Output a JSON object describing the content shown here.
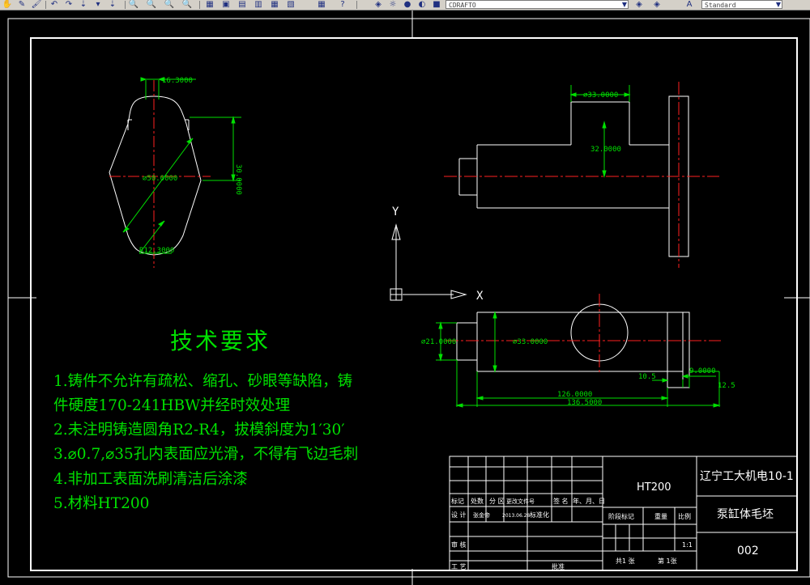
{
  "toolbar": {
    "layer_combo": "CDRAFTO",
    "style_combo": "Standard",
    "icons": [
      "pan-icon",
      "pencil-icon",
      "match-properties-icon",
      "undo-icon",
      "redo-icon",
      "snap-icon",
      "zoom-realtime-icon",
      "zoom-window-icon",
      "zoom-previous-icon",
      "properties-icon",
      "design-center-icon",
      "tool-palettes-icon",
      "calculator-icon",
      "help-icon",
      "layer-manager-icon",
      "layer-state-icon",
      "layer-color-icon",
      "style-icon"
    ]
  },
  "views": {
    "left": {
      "dim_width": "16.3000",
      "dim_height": "30.0000",
      "dim_diameter": "⌀50.0000",
      "dim_radius": "R12.3000"
    },
    "top": {
      "dim_diameter_top": "⌀33.0000",
      "dim_height": "32.0000"
    },
    "front": {
      "dim_left_diameter": "⌀21.0000",
      "dim_center_diameter": "⌀33.0000",
      "dim_10_5": "10.5",
      "dim_9": "9.0000",
      "dim_12_5": "12.5",
      "dim_126": "126.0000",
      "dim_136_5": "136.5000"
    },
    "ucs": {
      "x_label": "X",
      "y_label": "Y"
    }
  },
  "tech_requirements": {
    "title": "技术要求",
    "lines": [
      "1.铸件不允许有疏松、缩孔、砂眼等缺陷，铸",
      "件硬度170-241HBW并经时效处理",
      "2.未注明铸造圆角R2-R4，拔模斜度为1′30′",
      "3.⌀0.7,⌀35孔内表面应光滑，不得有飞边毛刺",
      "4.非加工表面洗刷清洁后涂漆",
      "5.材料HT200"
    ]
  },
  "title_block": {
    "material": "HT200",
    "school": "辽宁工大机电10-1",
    "part_name": "泵缸体毛坯",
    "drawing_no": "002",
    "row_headers": [
      "标记",
      "处数",
      "分 区",
      "更改文件号",
      "签 名",
      "年、月、日"
    ],
    "design_label": "设 计",
    "designer": "张金帝",
    "design_date": "2013.06.28",
    "standardize_label": "标准化",
    "review_label": "审 核",
    "process_label": "工 艺",
    "approve_label": "批准",
    "stage_label": "阶段标记",
    "weight_label": "重量",
    "scale_label": "比例",
    "scale_value": "1:1",
    "sheets_total": "共1 张",
    "sheet_no": "第 1张"
  },
  "colors": {
    "background": "#000000",
    "outline": "#ffffff",
    "center_line": "#ff2020",
    "dimension": "#00e000",
    "hatch_line": "#ffff00"
  }
}
